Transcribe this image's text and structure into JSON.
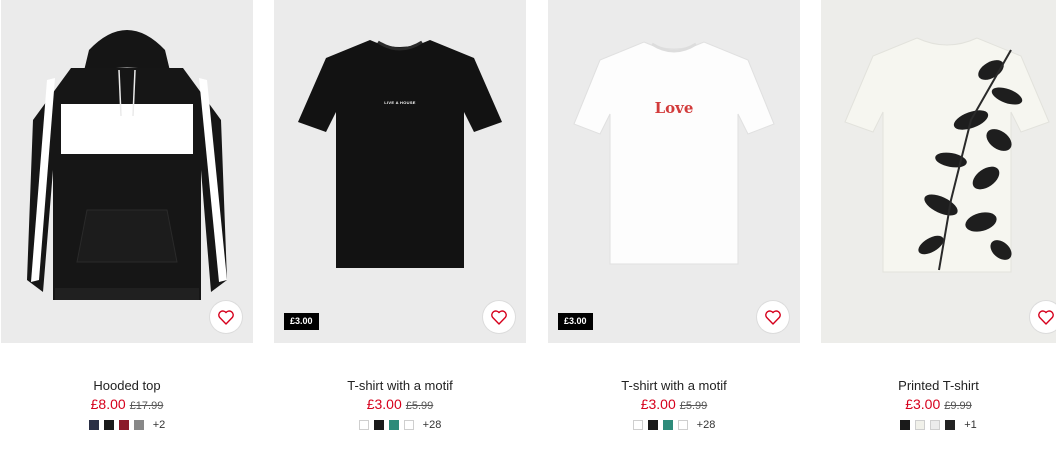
{
  "colors": {
    "sale": "#d6001c",
    "badge_bg": "#000000"
  },
  "products": [
    {
      "name": "Hooded top",
      "sale_price": "£8.00",
      "original_price": "£17.99",
      "badge": "",
      "swatches": [
        "#2a2f45",
        "#1a1a1a",
        "#8b1b2a",
        "#888888"
      ],
      "more": "+2",
      "favorite_icon": "heart-outline-icon"
    },
    {
      "name": "T-shirt with a motif",
      "sale_price": "£3.00",
      "original_price": "£5.99",
      "badge": "£3.00",
      "graphic_text": "LIVE A HOUSE",
      "swatches": [
        "#ffffff",
        "#1a1a1a",
        "#2e8b7a",
        "#ffffff"
      ],
      "more": "+28",
      "favorite_icon": "heart-outline-icon"
    },
    {
      "name": "T-shirt with a motif",
      "sale_price": "£3.00",
      "original_price": "£5.99",
      "badge": "£3.00",
      "graphic_text": "Love",
      "swatches": [
        "#ffffff",
        "#1a1a1a",
        "#2e8b7a",
        "#ffffff"
      ],
      "more": "+28",
      "favorite_icon": "heart-outline-icon"
    },
    {
      "name": "Printed T-shirt",
      "sale_price": "£3.00",
      "original_price": "£9.99",
      "badge": "",
      "swatches": [
        "#1a1a1a",
        "#f1f1ea",
        "#ececec",
        "#222222"
      ],
      "more": "+1",
      "favorite_icon": "heart-outline-icon"
    }
  ]
}
